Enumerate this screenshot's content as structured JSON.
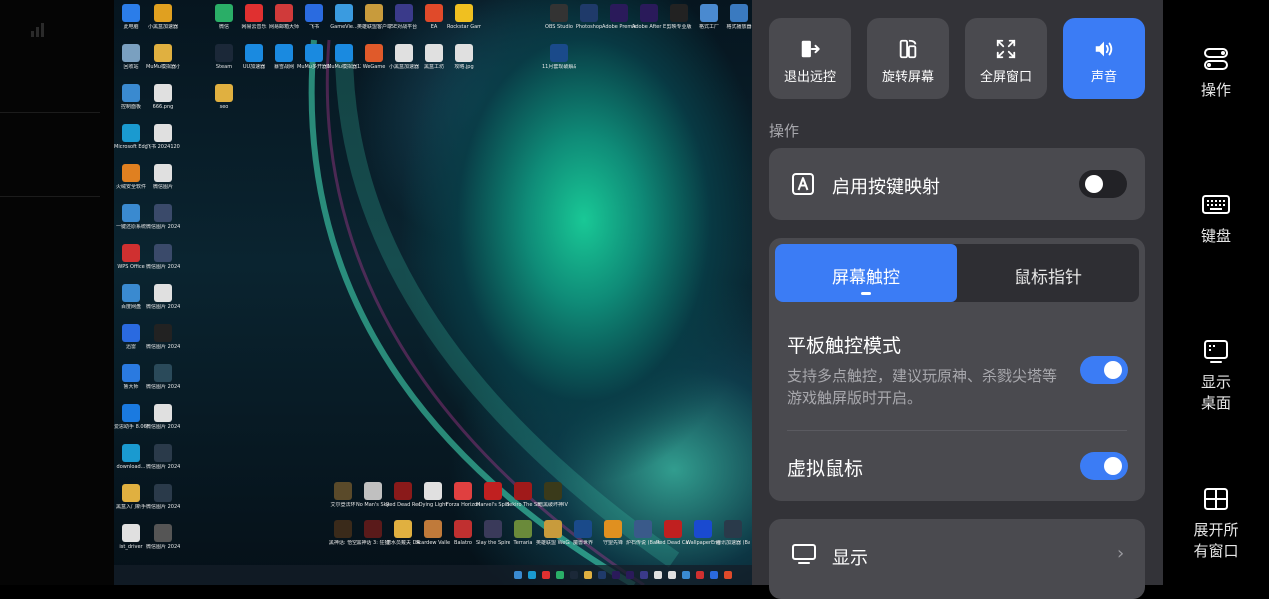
{
  "desktop": {
    "icons": [
      {
        "label": "此电脑",
        "color": "#2b7de9"
      },
      {
        "label": "小黑盒加速器",
        "color": "#e0a020"
      },
      {
        "label": "微信",
        "color": "#2aae67"
      },
      {
        "label": "网易云音乐",
        "color": "#e03030"
      },
      {
        "label": "网易邮箱大师",
        "color": "#d03a3a"
      },
      {
        "label": "飞书",
        "color": "#2a6be0"
      },
      {
        "label": "GameVie...",
        "color": "#3a9be0"
      },
      {
        "label": "英雄联盟客户端",
        "color": "#c89b3c"
      },
      {
        "label": "5E对战平台",
        "color": "#3a3a8a"
      },
      {
        "label": "EA",
        "color": "#e04a2a"
      },
      {
        "label": "Rockstar Games...",
        "color": "#f0c020"
      },
      {
        "label": "OBS Studio",
        "color": "#333333"
      },
      {
        "label": "Photoshop",
        "color": "#1f3a6a"
      },
      {
        "label": "Adobe Premie...",
        "color": "#2a1a5a"
      },
      {
        "label": "Adobe After Effects 2022",
        "color": "#2a1a5a"
      },
      {
        "label": "剪映专业版",
        "color": "#222222"
      },
      {
        "label": "格式工厂",
        "color": "#4a8ad0"
      },
      {
        "label": "格式播放器",
        "color": "#3a7ac0"
      },
      {
        "label": "回收站",
        "color": "#7aa0c0"
      },
      {
        "label": "MuMu模拟器小黑盒",
        "color": "#e0b040"
      },
      {
        "label": "Steam",
        "color": "#1b2838"
      },
      {
        "label": "UU加速器",
        "color": "#1a8ae0"
      },
      {
        "label": "暴雪战网",
        "color": "#1a8ae0"
      },
      {
        "label": "MuMu多开器12",
        "color": "#1a8ae0"
      },
      {
        "label": "MuMu模拟器12",
        "color": "#1a8ae0"
      },
      {
        "label": "WeGame",
        "color": "#e05a2a"
      },
      {
        "label": "小黑盒加速器",
        "color": "#e0e0e0"
      },
      {
        "label": "黑盒工坊",
        "color": "#e0e0e0"
      },
      {
        "label": "攻略.jpg",
        "color": "#e0e0e0"
      },
      {
        "label": "11月套现破解战胜式小...",
        "color": "#1a4a8a"
      },
      {
        "label": "控制面板",
        "color": "#3a8ad0"
      },
      {
        "label": "666.png",
        "color": "#e0e0e0"
      },
      {
        "label": "seo",
        "color": "#e0b040"
      },
      {
        "label": "Microsoft Edge",
        "color": "#1a9ad0"
      },
      {
        "label": "飞书 20241208...",
        "color": "#e0e0e0"
      },
      {
        "label": "火绒安全软件",
        "color": "#e08020"
      },
      {
        "label": "微信图片",
        "color": "#e0e0e0"
      },
      {
        "label": "一键还原系统",
        "color": "#3a8ad0"
      },
      {
        "label": "微信图片 20241120...",
        "color": "#3a4a6a"
      },
      {
        "label": "WPS Office",
        "color": "#d03030"
      },
      {
        "label": "微信图片 20241121...",
        "color": "#3a4a6a"
      },
      {
        "label": "百度网盘",
        "color": "#3a8ad0"
      },
      {
        "label": "微信图片 20241120...",
        "color": "#e0e0e0"
      },
      {
        "label": "迅雷",
        "color": "#2a6ae0"
      },
      {
        "label": "微信图片 20241120...",
        "color": "#222222"
      },
      {
        "label": "鲁大师",
        "color": "#2a7ae0"
      },
      {
        "label": "微信图片 20241120...",
        "color": "#2a4a5a"
      },
      {
        "label": "爱思助手 8.06W(0)",
        "color": "#1a7ae0"
      },
      {
        "label": "微信图片 20241120...",
        "color": "#e0e0e0"
      },
      {
        "label": "download...",
        "color": "#1a9ad0"
      },
      {
        "label": "微信图片 20241120...",
        "color": "#2a3a4a"
      },
      {
        "label": "黑盒入门新手",
        "color": "#e0b040"
      },
      {
        "label": "微信图片 20241120...",
        "color": "#2a3a4a"
      },
      {
        "label": "ist_driver",
        "color": "#e0e0e0"
      },
      {
        "label": "微信图片 20241208 013159.png",
        "color": "#555555"
      },
      {
        "label": "艾尔登法环",
        "color": "#5a4a2a"
      },
      {
        "label": "No Man's Sky 无人...",
        "color": "#c0c0c0"
      },
      {
        "label": "Red Dead Redempt...",
        "color": "#8a1a1a"
      },
      {
        "label": "Dying Light",
        "color": "#e0e0e0"
      },
      {
        "label": "Forza Horizon",
        "color": "#e04040"
      },
      {
        "label": "Marvel's Spider-Ma...",
        "color": "#c02020"
      },
      {
        "label": "Sekiro The Shadows",
        "color": "#a01a1a"
      },
      {
        "label": "暗黑破坏神IV",
        "color": "#3a3a1a"
      },
      {
        "label": "黑神话: 悟空",
        "color": "#3a2a1a"
      },
      {
        "label": "黑神话 3: 狂猎",
        "color": "#5a1a1a"
      },
      {
        "label": "潜水员戴夫 DAVE T...",
        "color": "#e0b040"
      },
      {
        "label": "Stardew Valley",
        "color": "#c07a3a"
      },
      {
        "label": "Balatro",
        "color": "#c03030"
      },
      {
        "label": "Slay the Spire",
        "color": "#3a3a5a"
      },
      {
        "label": "Terraria",
        "color": "#6a8a3a"
      },
      {
        "label": "英雄联盟 WeGame版",
        "color": "#c89b3c"
      },
      {
        "label": "魔兽世界",
        "color": "#1a4a8a"
      },
      {
        "label": "守望先锋",
        "color": "#e09020"
      },
      {
        "label": "炉石传说 (Battle.net)",
        "color": "#3a5a8a"
      },
      {
        "label": "Red Dead Ca...",
        "color": "#c02020"
      },
      {
        "label": "WallpaperEngine...",
        "color": "#1a4ad0"
      },
      {
        "label": "腾讯加速器 (Battle.net)",
        "color": "#2a3a4a"
      }
    ]
  },
  "controls": {
    "top_buttons": [
      {
        "label": "退出远控",
        "icon": "exit-remote-icon",
        "active": false
      },
      {
        "label": "旋转屏幕",
        "icon": "rotate-screen-icon",
        "active": false
      },
      {
        "label": "全屏窗口",
        "icon": "fullscreen-icon",
        "active": false
      },
      {
        "label": "声音",
        "icon": "speaker-icon",
        "active": true
      }
    ],
    "section_title": "操作",
    "keymap": {
      "label": "启用按键映射",
      "enabled": false
    },
    "segments": {
      "touch": "屏幕触控",
      "mouse": "鼠标指针",
      "selected": "touch"
    },
    "tablet_mode": {
      "title": "平板触控模式",
      "description": "支持多点触控，建议玩原神、杀戮尖塔等游戏触屏版时开启。",
      "enabled": true
    },
    "virtual_mouse": {
      "label": "虚拟鼠标",
      "enabled": true
    },
    "display": {
      "label": "显示",
      "chevron": "›"
    }
  },
  "sidebar": {
    "items": [
      {
        "label": "操作",
        "icon": "operation-icon"
      },
      {
        "label": "键盘",
        "icon": "keyboard-icon"
      },
      {
        "label": "显示桌面",
        "icon": "show-desktop-icon"
      },
      {
        "label": "展开所有窗口",
        "icon": "expand-windows-icon"
      }
    ]
  },
  "colors": {
    "accent": "#3b7cf5",
    "panel": "#333338",
    "card": "#4a4a4f"
  }
}
